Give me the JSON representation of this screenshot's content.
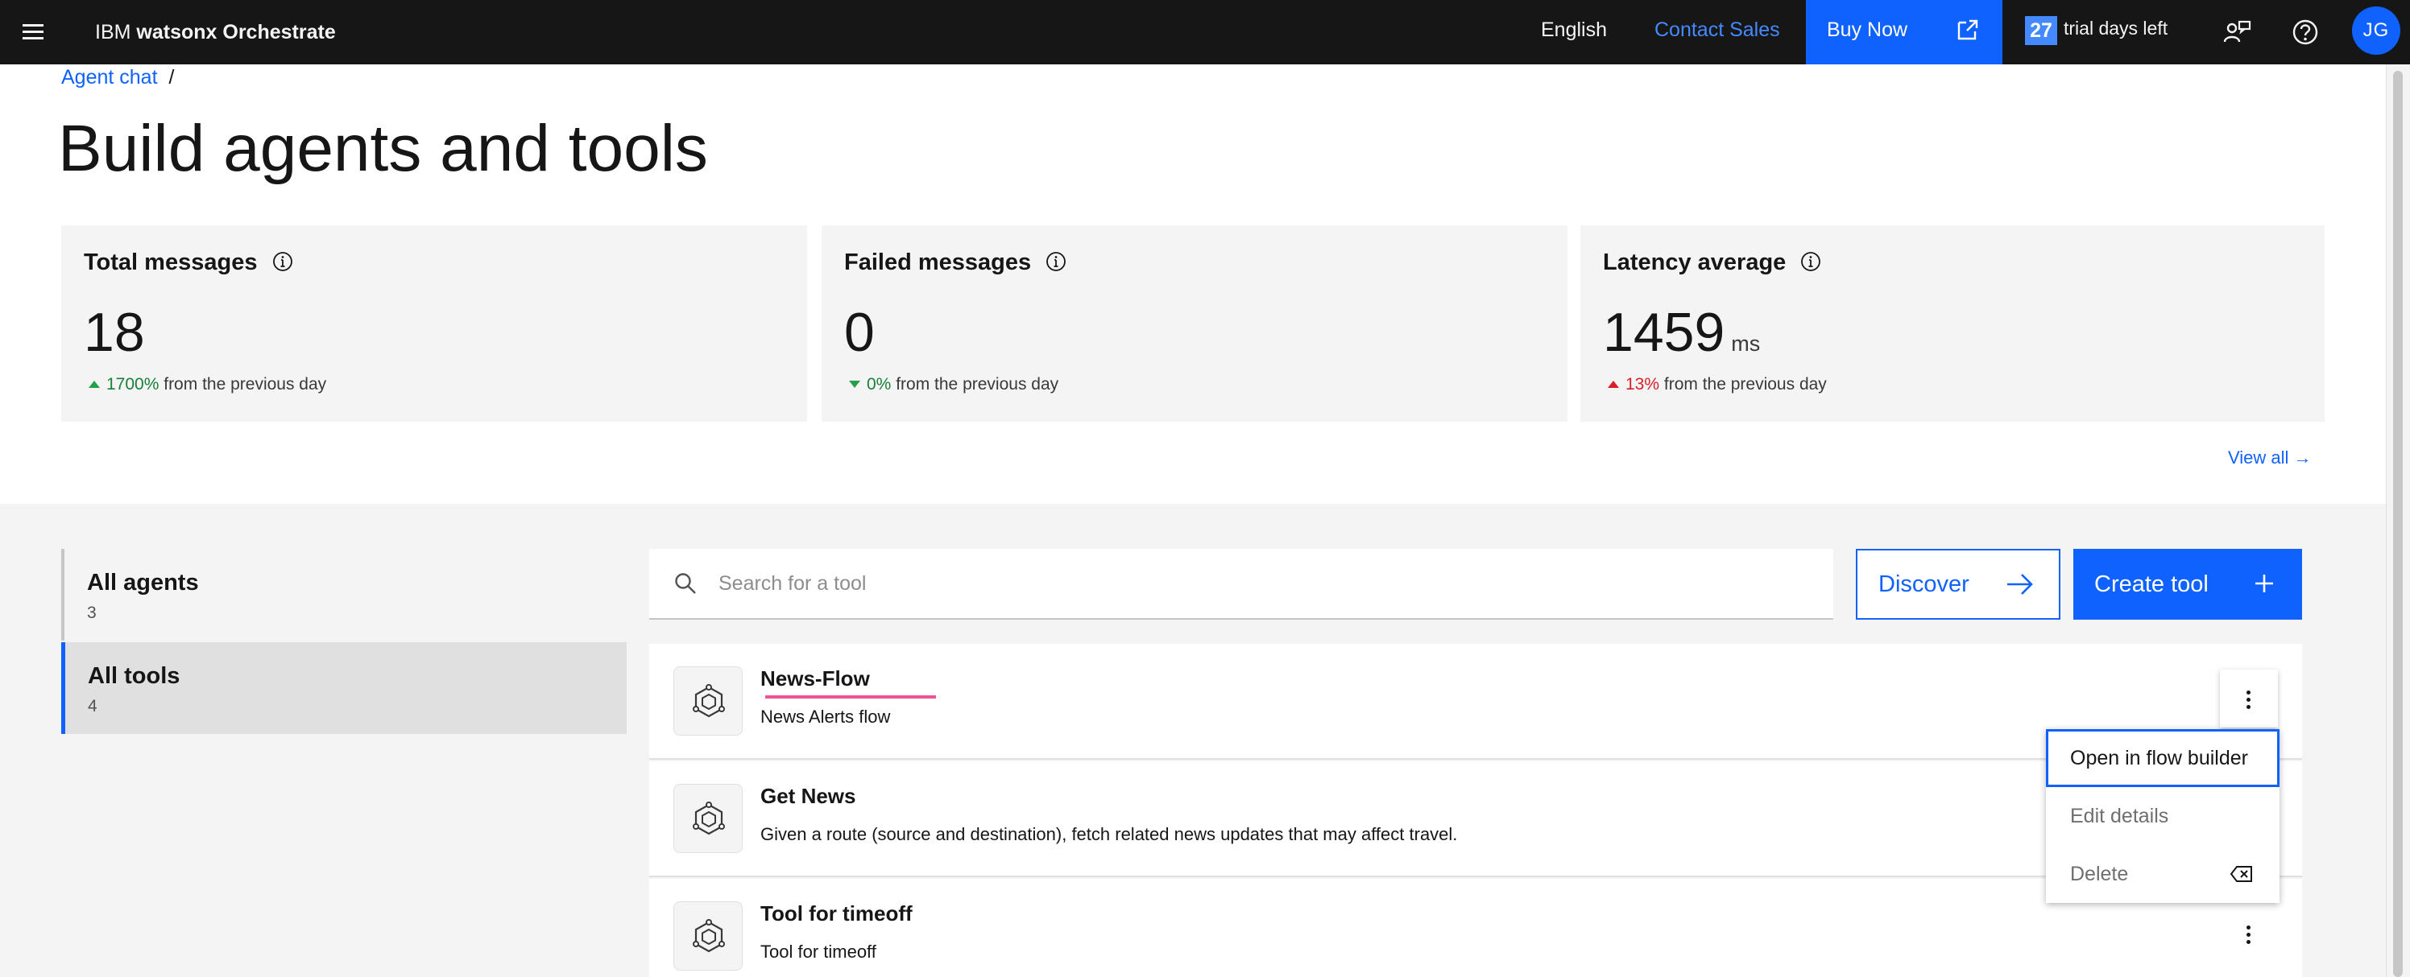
{
  "header": {
    "brand_prefix": "IBM",
    "brand_product": "watsonx Orchestrate",
    "language": "English",
    "contact_sales": "Contact Sales",
    "buy_now": "Buy Now",
    "trial_days": "27",
    "trial_text": "trial days left",
    "avatar_initials": "JG",
    "icons": [
      "menu-icon",
      "launch-icon",
      "user-feedback-icon",
      "help-icon"
    ]
  },
  "breadcrumb": {
    "items": [
      "Agent chat"
    ],
    "separator": "/"
  },
  "page_title": "Build agents and tools",
  "metrics": [
    {
      "title": "Total messages",
      "value": "18",
      "unit": "",
      "change_pct": "1700%",
      "change_text": "from the previous day",
      "trend": "up",
      "trend_color": "#24a148"
    },
    {
      "title": "Failed messages",
      "value": "0",
      "unit": "",
      "change_pct": "0%",
      "change_text": "from the previous day",
      "trend": "down",
      "trend_color": "#24a148"
    },
    {
      "title": "Latency average",
      "value": "1459",
      "unit": "ms",
      "change_pct": "13%",
      "change_text": "from the previous day",
      "trend": "up",
      "trend_color": "#da1e28"
    }
  ],
  "view_all": "View all →",
  "sidebar": {
    "items": [
      {
        "label": "All agents",
        "count": "3",
        "selected": false
      },
      {
        "label": "All tools",
        "count": "4",
        "selected": true
      }
    ]
  },
  "search": {
    "placeholder": "Search for a tool",
    "value": ""
  },
  "buttons": {
    "discover": "Discover",
    "create_tool": "Create tool"
  },
  "tools": [
    {
      "name": "News-Flow",
      "description": "News Alerts flow"
    },
    {
      "name": "Get News",
      "description": "Given a route (source and destination), fetch related news updates that may affect travel."
    },
    {
      "name": "Tool for timeoff",
      "description": "Tool for timeoff"
    }
  ],
  "overflow_menu": {
    "items": [
      "Open in flow builder",
      "Edit details",
      "Delete"
    ]
  },
  "colors": {
    "header_bg": "#161616",
    "accent": "#0f62fe",
    "surface": "#f4f4f4",
    "positive": "#24a148",
    "negative": "#da1e28",
    "highlight_underline": "#ee5396"
  }
}
